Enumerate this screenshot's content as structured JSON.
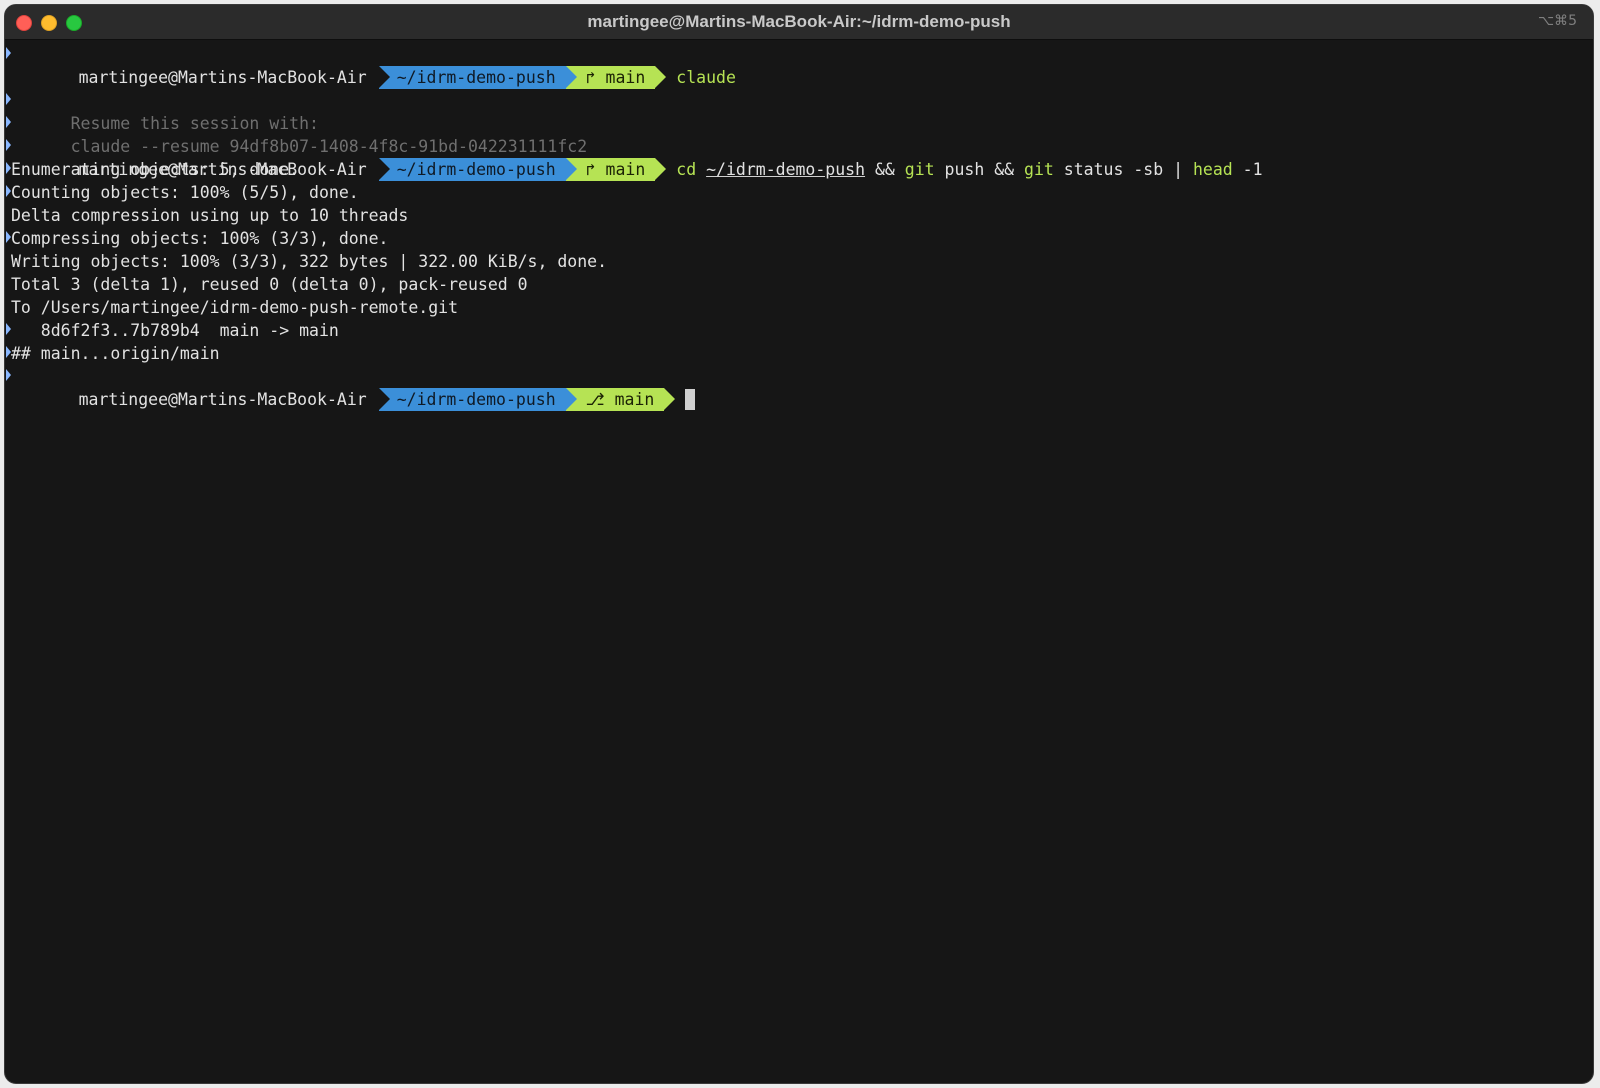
{
  "window": {
    "title": "martingee@Martins-MacBook-Air:~/idrm-demo-push",
    "shortcut": "⌥⌘5"
  },
  "prompt": {
    "user_host": "martingee@Martins-MacBook-Air",
    "dir": "~/idrm-demo-push",
    "branch_icon_1": "↱",
    "branch_icon_2": "↱",
    "branch_icon_3": "⎇",
    "branch": "main"
  },
  "cmd1": {
    "text": "claude"
  },
  "resume": {
    "line1": "Resume this session with:",
    "line2": "claude --resume 94df8b07-1408-4f8c-91bd-042231111fc2"
  },
  "cmd2": {
    "cd": "cd",
    "path": "~/idrm-demo-push",
    "and1": "&&",
    "git1": "git",
    "push": "push",
    "and2": "&&",
    "git2": "git",
    "status": "status -sb",
    "pipe": "|",
    "head": "head",
    "head_arg": "-1"
  },
  "output": [
    "Enumerating objects: 5, done.",
    "Counting objects: 100% (5/5), done.",
    "Delta compression using up to 10 threads",
    "Compressing objects: 100% (3/3), done.",
    "Writing objects: 100% (3/3), 322 bytes | 322.00 KiB/s, done.",
    "Total 3 (delta 1), reused 0 (delta 0), pack-reused 0",
    "To /Users/martingee/idrm-demo-push-remote.git",
    "   8d6f2f3..7b789b4  main -> main",
    "## main...origin/main"
  ],
  "colors": {
    "background": "#161616",
    "dir_segment": "#3b8fd9",
    "git_segment": "#b6e354",
    "command": "#b6e354",
    "dim": "#6f6f6f"
  }
}
